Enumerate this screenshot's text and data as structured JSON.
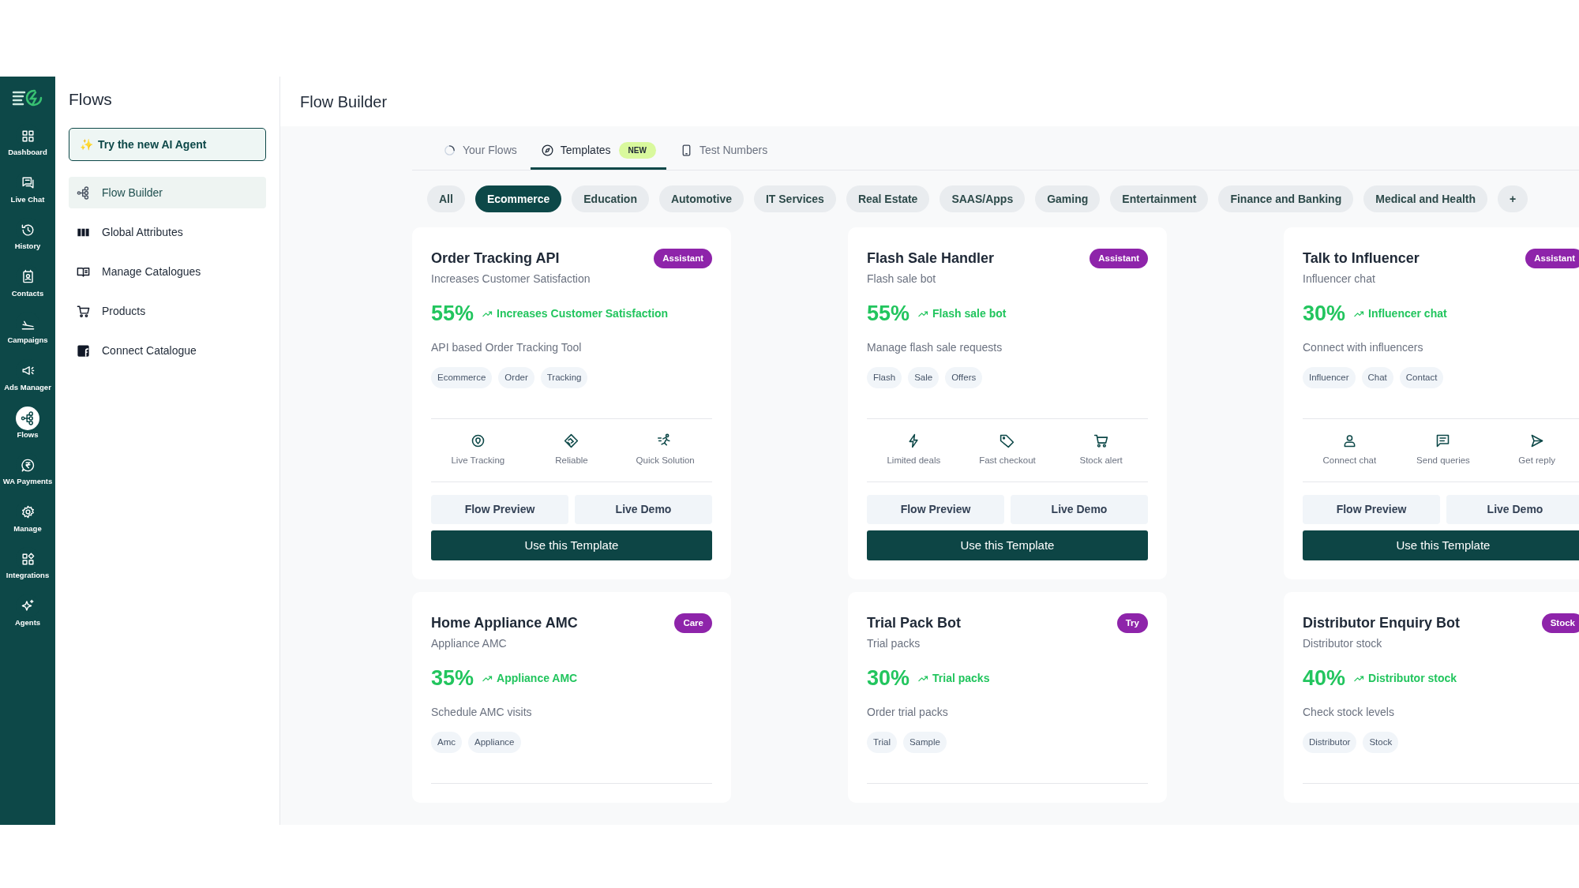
{
  "nav": {
    "items": [
      {
        "label": "Dashboard",
        "selected": false
      },
      {
        "label": "Live Chat",
        "selected": false
      },
      {
        "label": "History",
        "selected": false
      },
      {
        "label": "Contacts",
        "selected": false
      },
      {
        "label": "Campaigns",
        "selected": false
      },
      {
        "label": "Ads Manager",
        "selected": false
      },
      {
        "label": "Flows",
        "selected": true
      },
      {
        "label": "WA Payments",
        "selected": false
      },
      {
        "label": "Manage",
        "selected": false
      },
      {
        "label": "Integrations",
        "selected": false
      },
      {
        "label": "Agents",
        "selected": false
      }
    ]
  },
  "sidebar": {
    "title": "Flows",
    "ai_button": {
      "icon": "✨",
      "label": "Try the new AI Agent"
    },
    "items": [
      {
        "label": "Flow Builder",
        "selected": true
      },
      {
        "label": "Global Attributes",
        "selected": false
      },
      {
        "label": "Manage Catalogues",
        "selected": false
      },
      {
        "label": "Products",
        "selected": false
      },
      {
        "label": "Connect Catalogue",
        "selected": false
      }
    ]
  },
  "header": {
    "title": "Flow Builder"
  },
  "tabs": [
    {
      "label": "Your Flows",
      "selected": false
    },
    {
      "label": "Templates",
      "selected": true,
      "badge": "NEW"
    },
    {
      "label": "Test Numbers",
      "selected": false
    }
  ],
  "filters": [
    {
      "label": "All",
      "selected": false
    },
    {
      "label": "Ecommerce",
      "selected": true
    },
    {
      "label": "Education",
      "selected": false
    },
    {
      "label": "Automotive",
      "selected": false
    },
    {
      "label": "IT Services",
      "selected": false
    },
    {
      "label": "Real Estate",
      "selected": false
    },
    {
      "label": "SAAS/Apps",
      "selected": false
    },
    {
      "label": "Gaming",
      "selected": false
    },
    {
      "label": "Entertainment",
      "selected": false
    },
    {
      "label": "Finance and Banking",
      "selected": false
    },
    {
      "label": "Medical and Health",
      "selected": false
    },
    {
      "label": "+",
      "selected": false
    }
  ],
  "cards": [
    {
      "title": "Order Tracking API",
      "badge": "Assistant",
      "subtitle": "Increases Customer Satisfaction",
      "percent": "55%",
      "trend": "Increases Customer Satisfaction",
      "description": "API based Order Tracking Tool",
      "tags": [
        "Ecommerce",
        "Order",
        "Tracking"
      ],
      "features": [
        "Live Tracking",
        "Reliable",
        "Quick Solution"
      ],
      "buttons": [
        "Flow Preview",
        "Live Demo"
      ],
      "action": "Use this Template"
    },
    {
      "title": "Flash Sale Handler",
      "badge": "Assistant",
      "subtitle": "Flash sale bot",
      "percent": "55%",
      "trend": "Flash sale bot",
      "description": "Manage flash sale requests",
      "tags": [
        "Flash",
        "Sale",
        "Offers"
      ],
      "features": [
        "Limited deals",
        "Fast checkout",
        "Stock alert"
      ],
      "buttons": [
        "Flow Preview",
        "Live Demo"
      ],
      "action": "Use this Template"
    },
    {
      "title": "Talk to Influencer",
      "badge": "Assistant",
      "subtitle": "Influencer chat",
      "percent": "30%",
      "trend": "Influencer chat",
      "description": "Connect with influencers",
      "tags": [
        "Influencer",
        "Chat",
        "Contact"
      ],
      "features": [
        "Connect chat",
        "Send queries",
        "Get reply"
      ],
      "buttons": [
        "Flow Preview",
        "Live Demo"
      ],
      "action": "Use this Template"
    },
    {
      "title": "Home Appliance AMC",
      "badge": "Care",
      "subtitle": "Appliance AMC",
      "percent": "35%",
      "trend": "Appliance AMC",
      "description": "Schedule AMC visits",
      "tags": [
        "Amc",
        "Appliance"
      ]
    },
    {
      "title": "Trial Pack Bot",
      "badge": "Try",
      "subtitle": "Trial packs",
      "percent": "30%",
      "trend": "Trial packs",
      "description": "Order trial packs",
      "tags": [
        "Trial",
        "Sample"
      ]
    },
    {
      "title": "Distributor Enquiry Bot",
      "badge": "Stock",
      "subtitle": "Distributor stock",
      "percent": "40%",
      "trend": "Distributor stock",
      "description": "Check stock levels",
      "tags": [
        "Distributor",
        "Stock"
      ]
    }
  ]
}
